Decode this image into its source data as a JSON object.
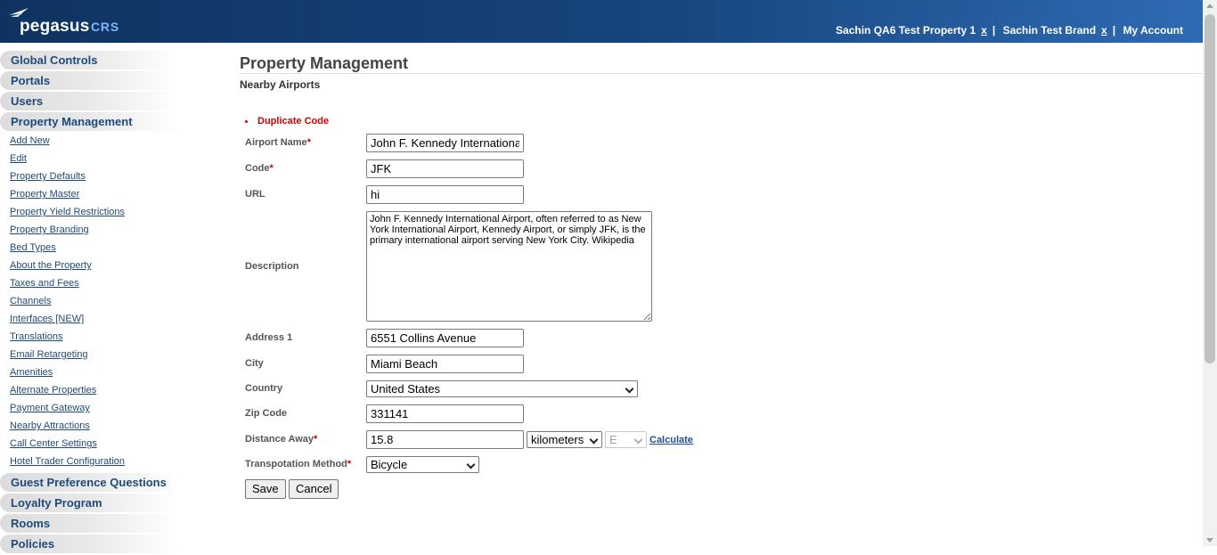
{
  "header": {
    "logo_text": "pegasus",
    "logo_suffix": "CRS",
    "property": "Sachin QA6 Test Property 1",
    "property_close": "x",
    "separator": "|",
    "brand": "Sachin Test Brand",
    "brand_close": "x",
    "my_account": "My Account"
  },
  "sidebar": {
    "top_sections": [
      "Global Controls",
      "Portals",
      "Users",
      "Property Management"
    ],
    "property_links": [
      "Add New",
      "Edit",
      "Property Defaults",
      "Property Master",
      "Property Yield Restrictions",
      "Property Branding",
      "Bed Types",
      "About the Property",
      "Taxes and Fees",
      "Channels",
      "Interfaces [NEW]",
      "Translations",
      "Email Retargeting",
      "Amenities",
      "Alternate Properties",
      "Payment Gateway",
      "Nearby Attractions",
      "Call Center Settings",
      "Hotel Trader Configuration"
    ],
    "bottom_sections": [
      "Guest Preference Questions",
      "Loyalty Program",
      "Rooms",
      "Policies"
    ]
  },
  "main": {
    "title": "Property Management",
    "subtitle": "Nearby Airports",
    "error": "Duplicate Code"
  },
  "form": {
    "required_mark": "*",
    "airport_name_label": "Airport Name",
    "airport_name_value": "John F. Kennedy International Airport",
    "code_label": "Code",
    "code_value": "JFK",
    "url_label": "URL",
    "url_value": "hi",
    "description_label": "Description",
    "description_value": "John F. Kennedy International Airport, often referred to as New York International Airport, Kennedy Airport, or simply JFK, is the primary international airport serving New York City. Wikipedia",
    "address1_label": "Address 1",
    "address1_value": "6551 Collins Avenue",
    "city_label": "City",
    "city_value": "Miami Beach",
    "country_label": "Country",
    "country_value": "United States",
    "zip_label": "Zip Code",
    "zip_value": "331141",
    "distance_label": "Distance Away",
    "distance_value": "15.8",
    "distance_unit": "kilometers",
    "direction_value": "E",
    "calculate": "Calculate",
    "transport_label": "Transpotation Method",
    "transport_value": "Bicycle",
    "save": "Save",
    "cancel": "Cancel"
  },
  "colors": {
    "header_dark": "#0f3360",
    "header_light": "#2f6bb3",
    "nav_text": "#1e4a7b",
    "error": "#d00000",
    "required": "#c00000",
    "link": "#1d4d9b"
  }
}
